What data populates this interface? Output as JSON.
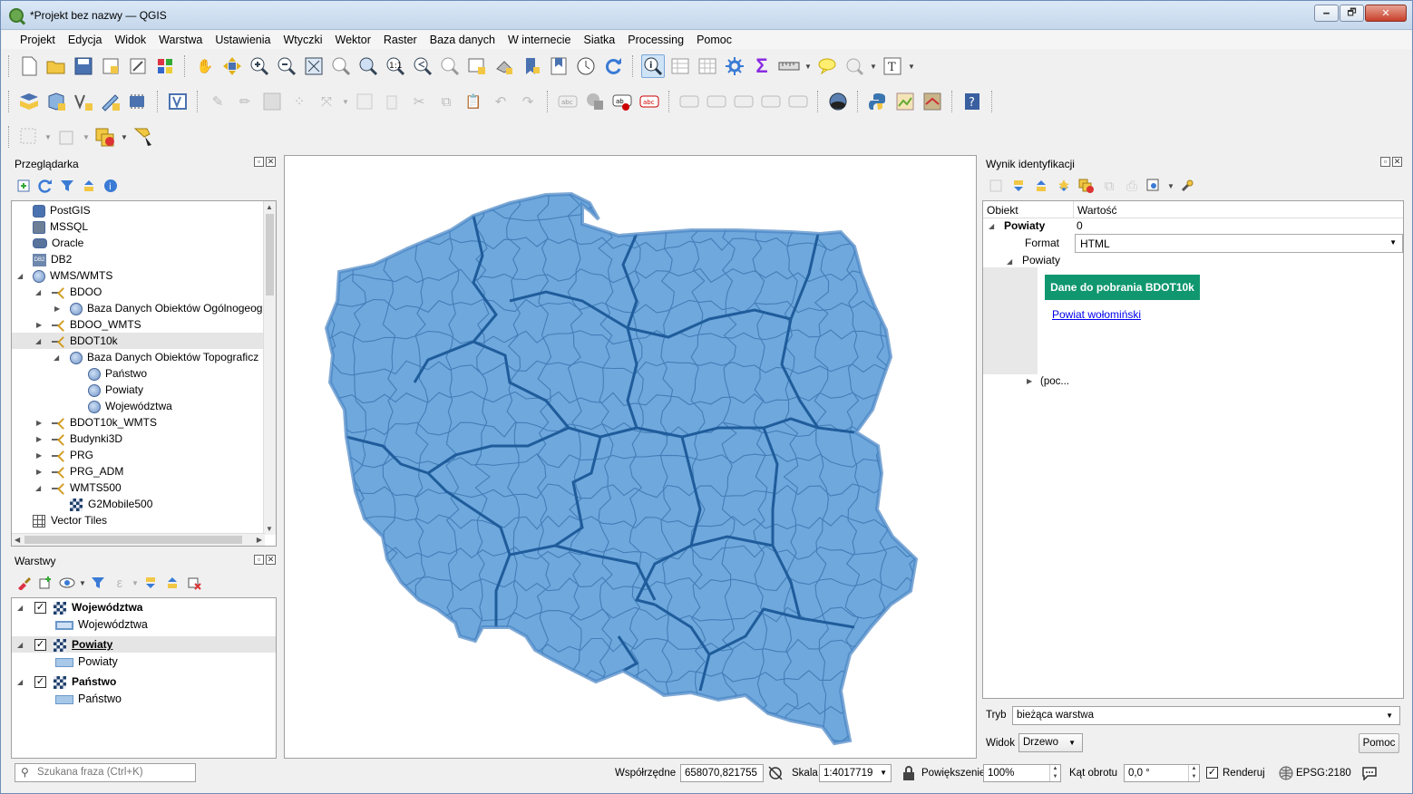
{
  "window": {
    "title": "*Projekt bez nazwy — QGIS",
    "minimize": "🗕",
    "maximize": "🗗",
    "close": "✕"
  },
  "menu": [
    "Projekt",
    "Edycja",
    "Widok",
    "Warstwa",
    "Ustawienia",
    "Wtyczki",
    "Wektor",
    "Raster",
    "Baza danych",
    "W internecie",
    "Siatka",
    "Processing",
    "Pomoc"
  ],
  "browser": {
    "title": "Przeglądarka",
    "items": [
      {
        "label": "PostGIS",
        "icon": "postgis-icon"
      },
      {
        "label": "MSSQL",
        "icon": "mssql-icon"
      },
      {
        "label": "Oracle",
        "icon": "oracle-icon"
      },
      {
        "label": "DB2",
        "icon": "db2-icon",
        "badge": "DB2"
      },
      {
        "label": "WMS/WMTS",
        "icon": "wms-icon"
      },
      {
        "label": "BDOO",
        "icon": "wms-connection-icon"
      },
      {
        "label": "Baza Danych Obiektów Ogólnogeog",
        "icon": "globe-icon"
      },
      {
        "label": "BDOO_WMTS",
        "icon": "wms-connection-icon"
      },
      {
        "label": "BDOT10k",
        "icon": "wms-connection-icon"
      },
      {
        "label": "Baza Danych Obiektów Topograficz",
        "icon": "globe-icon"
      },
      {
        "label": "Państwo",
        "icon": "globe-icon"
      },
      {
        "label": "Powiaty",
        "icon": "globe-icon"
      },
      {
        "label": "Województwa",
        "icon": "globe-icon"
      },
      {
        "label": "BDOT10k_WMTS",
        "icon": "wms-connection-icon"
      },
      {
        "label": "Budynki3D",
        "icon": "wms-connection-icon"
      },
      {
        "label": "PRG",
        "icon": "wms-connection-icon"
      },
      {
        "label": "PRG_ADM",
        "icon": "wms-connection-icon"
      },
      {
        "label": "WMTS500",
        "icon": "wms-connection-icon"
      },
      {
        "label": "G2Mobile500",
        "icon": "tile-layer-icon"
      },
      {
        "label": "Vector Tiles",
        "icon": "vector-tiles-icon"
      }
    ]
  },
  "layers": {
    "title": "Warstwy",
    "items": [
      {
        "name": "Województwa",
        "legend": "Województwa",
        "checked": "✓"
      },
      {
        "name": "Powiaty",
        "legend": "Powiaty",
        "checked": "✓"
      },
      {
        "name": "Państwo",
        "legend": "Państwo",
        "checked": "✓"
      }
    ]
  },
  "identify": {
    "title": "Wynik identyfikacji",
    "col_feature": "Obiekt",
    "col_value": "Wartość",
    "layer_name": "Powiaty",
    "layer_count": "0",
    "format_label": "Format",
    "format_value": "HTML",
    "feature_name": "Powiaty",
    "download_button": "Dane do pobrania BDOT10k",
    "link_text": "Powiat wołomiński",
    "more_row": "(poc...",
    "mode_label": "Tryb",
    "mode_value": "bieżąca warstwa",
    "view_label": "Widok",
    "view_value": "Drzewo",
    "help_button": "Pomoc"
  },
  "status": {
    "search_placeholder": "Szukana fraza (Ctrl+K)",
    "coords_label": "Współrzędne",
    "coords_value": "658070,821755",
    "scale_label": "Skala",
    "scale_value": "1:4017719",
    "magnifier_label": "Powiększenie",
    "magnifier_value": "100%",
    "rotation_label": "Kąt obrotu",
    "rotation_value": "0,0 °",
    "render_label": "Renderuj",
    "crs": "EPSG:2180"
  },
  "colors": {
    "map_fill": "#6fa8dc",
    "map_stroke": "#3a6fa8",
    "accent": "#10976f"
  }
}
